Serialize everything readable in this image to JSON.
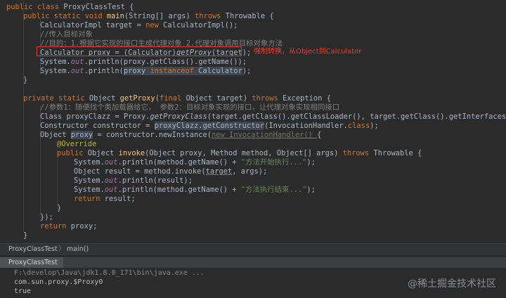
{
  "code_lines": [
    {
      "indent": 0,
      "tokens": [
        {
          "t": "public class ",
          "c": "kw"
        },
        {
          "t": "ProxyClassTest {"
        }
      ]
    },
    {
      "indent": 1,
      "tokens": [
        {
          "t": "public static void ",
          "c": "kw"
        },
        {
          "t": "main",
          "c": "fn"
        },
        {
          "t": "(String[] args) "
        },
        {
          "t": "throws ",
          "c": "kw"
        },
        {
          "t": "Throwable {"
        }
      ]
    },
    {
      "indent": 2,
      "tokens": [
        {
          "t": "CalculatorImpl target = "
        },
        {
          "t": "new ",
          "c": "kw"
        },
        {
          "t": "CalculatorImpl();"
        }
      ]
    },
    {
      "indent": 2,
      "tokens": [
        {
          "t": "//传入目标对象",
          "c": "cm"
        }
      ]
    },
    {
      "indent": 2,
      "tokens": [
        {
          "t": "//目的：1.根据它实现的接口生成代理对象 2.代理对象调用目标对象方法",
          "c": "cm"
        }
      ]
    },
    {
      "indent": 2,
      "tokens": [
        {
          "t": "Calculator proxy = (Calculator)"
        },
        {
          "t": "getProxy",
          "c": "it"
        },
        {
          "t": "(target);"
        }
      ]
    },
    {
      "indent": 2,
      "tokens": [
        {
          "t": "System."
        },
        {
          "t": "out",
          "c": "sf"
        },
        {
          "t": ".println(proxy.getClass().getName());"
        }
      ]
    },
    {
      "indent": 2,
      "tokens": [
        {
          "t": "System."
        },
        {
          "t": "out",
          "c": "sf"
        },
        {
          "t": ".println("
        },
        {
          "t": "proxy ",
          "c": "hl"
        },
        {
          "t": "instanceof ",
          "c": "kw hl"
        },
        {
          "t": "Calculator",
          "c": "hl"
        },
        {
          "t": ");"
        }
      ]
    },
    {
      "indent": 1,
      "tokens": [
        {
          "t": "}"
        }
      ]
    },
    {
      "indent": 0,
      "tokens": []
    },
    {
      "indent": 1,
      "tokens": [
        {
          "t": "private static ",
          "c": "kw"
        },
        {
          "t": "Object "
        },
        {
          "t": "getProxy",
          "c": "fn"
        },
        {
          "t": "("
        },
        {
          "t": "final ",
          "c": "kw"
        },
        {
          "t": "Object target) "
        },
        {
          "t": "throws ",
          "c": "kw"
        },
        {
          "t": "Exception {"
        }
      ]
    },
    {
      "indent": 2,
      "tokens": [
        {
          "t": "//参数1：随便找个类加载器给它， 参数2：目标对象实现的接口，让代理对象实现相同接口",
          "c": "cm"
        }
      ]
    },
    {
      "indent": 2,
      "tokens": [
        {
          "t": "Class proxyClazz = Proxy."
        },
        {
          "t": "getProxyClass",
          "c": "it"
        },
        {
          "t": "(target.getClass().getClassLoader(), target.getClass().getInterfaces());"
        }
      ]
    },
    {
      "indent": 2,
      "tokens": [
        {
          "t": "Constructor constructor = "
        },
        {
          "t": "proxyClazz.getConstructor",
          "c": "hl"
        },
        {
          "t": "(InvocationHandler."
        },
        {
          "t": "class",
          "c": "kw"
        },
        {
          "t": ");"
        }
      ]
    },
    {
      "indent": 2,
      "tokens": [
        {
          "t": "Object "
        },
        {
          "t": "proxy",
          "c": "hl"
        },
        {
          "t": " = constructor.newInstance("
        },
        {
          "t": "new InvocationHandler() ",
          "c": "dim ul"
        },
        {
          "t": "{"
        }
      ]
    },
    {
      "indent": 3,
      "tokens": [
        {
          "t": "@Override",
          "c": "an"
        }
      ]
    },
    {
      "indent": 3,
      "tokens": [
        {
          "t": "public ",
          "c": "kw"
        },
        {
          "t": "Object "
        },
        {
          "t": "invoke",
          "c": "fn"
        },
        {
          "t": "(Object proxy, Method method, Object[] args) "
        },
        {
          "t": "throws ",
          "c": "kw"
        },
        {
          "t": "Throwable {"
        }
      ]
    },
    {
      "indent": 4,
      "tokens": [
        {
          "t": "System."
        },
        {
          "t": "out",
          "c": "sf"
        },
        {
          "t": ".println(method.getName() + "
        },
        {
          "t": "\"方法开始执行...\"",
          "c": "st"
        },
        {
          "t": ");"
        }
      ]
    },
    {
      "indent": 4,
      "tokens": [
        {
          "t": "Object result = method.invoke("
        },
        {
          "t": "target",
          "c": "ul"
        },
        {
          "t": ", args);"
        }
      ]
    },
    {
      "indent": 4,
      "tokens": [
        {
          "t": "System."
        },
        {
          "t": "out",
          "c": "sf"
        },
        {
          "t": ".println(result);"
        }
      ]
    },
    {
      "indent": 4,
      "tokens": [
        {
          "t": "System."
        },
        {
          "t": "out",
          "c": "sf"
        },
        {
          "t": ".println(method.getName() + "
        },
        {
          "t": "\"方法执行结束...\"",
          "c": "st"
        },
        {
          "t": ");"
        }
      ]
    },
    {
      "indent": 4,
      "tokens": [
        {
          "t": "return ",
          "c": "kw"
        },
        {
          "t": "result;"
        }
      ]
    },
    {
      "indent": 3,
      "tokens": [
        {
          "t": "}"
        }
      ]
    },
    {
      "indent": 2,
      "tokens": [
        {
          "t": "});"
        }
      ]
    },
    {
      "indent": 2,
      "tokens": [
        {
          "t": "return ",
          "c": "kw"
        },
        {
          "t": "proxy;"
        }
      ]
    },
    {
      "indent": 1,
      "tokens": [
        {
          "t": "}"
        }
      ]
    },
    {
      "indent": 0,
      "tokens": [
        {
          "t": "}"
        }
      ]
    }
  ],
  "annotation": {
    "text": "强制转换，从Object到Calculator"
  },
  "breadcrumb": {
    "class_name": "ProxyClassTest",
    "separator": "〉",
    "method": "main()"
  },
  "run_panel": {
    "tab_label": "ProxyClassTest"
  },
  "console": {
    "lines": [
      {
        "text": "F:\\develop\\Java\\jdk1.8.0_171\\bin\\java.exe ...",
        "kind": "path"
      },
      {
        "text": "com.sun.proxy.$Proxy0",
        "kind": "out"
      },
      {
        "text": "true",
        "kind": "out"
      }
    ]
  },
  "watermark": {
    "text": "@稀土掘金技术社区"
  }
}
